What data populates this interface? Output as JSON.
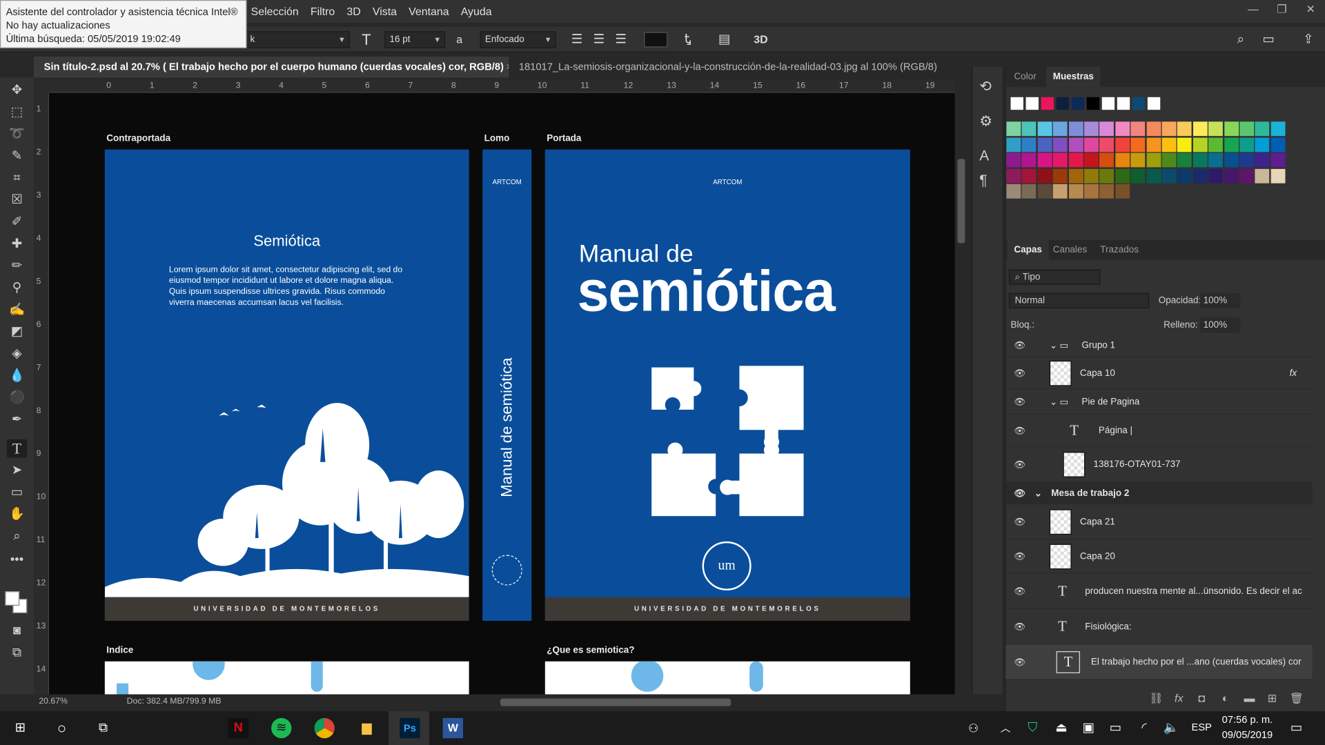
{
  "tooltip": {
    "line1": "Asistente del controlador y asistencia técnica Intel®",
    "line2": "No hay actualizaciones",
    "line3": "Última búsqueda: 05/05/2019 19:02:49"
  },
  "menu": [
    "Selección",
    "Filtro",
    "3D",
    "Vista",
    "Ventana",
    "Ayuda"
  ],
  "window_controls": {
    "minimize": "—",
    "restore": "❐",
    "close": "✕"
  },
  "options": {
    "font_style_partial": "k",
    "font_size_glyph": "T",
    "font_size": "16 pt",
    "aa_glyph": "a",
    "antialias": "Enfocado",
    "three_d": "3D"
  },
  "tabs": [
    {
      "label": "Sin título-2.psd al 20.7% (  El trabajo hecho por el  cuerpo humano (cuerdas  vocales) cor, RGB/8)",
      "close": "×"
    },
    {
      "label": "181017_La-semiosis-organizacional-y-la-construcción-de-la-realidad-03.jpg al 100% (RGB/8)",
      "close": "×"
    }
  ],
  "ruler": {
    "h_marks": [
      "0",
      "1",
      "2",
      "3",
      "4",
      "5",
      "6",
      "7",
      "8",
      "9",
      "10",
      "11",
      "12",
      "13",
      "14",
      "15",
      "16",
      "17",
      "18",
      "19"
    ],
    "v_marks": [
      "1",
      "2",
      "3",
      "4",
      "5",
      "6",
      "7",
      "8",
      "9",
      "10",
      "11",
      "12",
      "13",
      "14"
    ]
  },
  "canvas": {
    "labels": {
      "back": "Contraportada",
      "spine": "Lomo",
      "front": "Portada",
      "index": "Indice",
      "que": "¿Que es semiotica?"
    },
    "back": {
      "title": "Semiótica",
      "body": "Lorem ipsum dolor sit amet, consectetur adipiscing elit, sed do eiusmod tempor incididunt ut labore et dolore magna aliqua. Quis ipsum suspendisse ultrices gravida. Risus commodo viverra maecenas accumsan lacus vel facilisis.",
      "footer": "UNIVERSIDAD DE MONTEMORELOS"
    },
    "spine": {
      "publisher": "ARTCOM",
      "title": "Manual de semiótica"
    },
    "front": {
      "publisher": "ARTCOM",
      "title_small": "Manual de",
      "title_big": "semiótica",
      "seal_text": "um",
      "footer": "UNIVERSIDAD DE MONTEMORELOS"
    }
  },
  "status": {
    "zoom": "20.67%",
    "doc": "Doc: 382.4 MB/799.9 MB"
  },
  "color_panel": {
    "tabs": [
      "Color",
      "Muestras"
    ],
    "recent": [
      "#ffffff",
      "#ffffff",
      "#e8175d",
      "#0f1e3c",
      "#0c2a55",
      "#000000",
      "#ffffff",
      "#ffffff",
      "#0c4a73",
      "#ffffff"
    ],
    "grid": [
      [
        "#7fd3a0",
        "#4dc3b9",
        "#58c6e6",
        "#6aa6e0",
        "#7f8ed8",
        "#a98ad8",
        "#d88ad8",
        "#f08abf",
        "#f2857f",
        "#f58a5c",
        "#f8a85a",
        "#f8cb5a",
        "#ffea5a",
        "#c7e25a",
        "#8ad65a",
        "#5ac76f",
        "#2eb89b",
        "#1ab2d6"
      ],
      [
        "#2e9fc7",
        "#2f7fc7",
        "#4c63c0",
        "#7f4fc0",
        "#b04fbe",
        "#e0479f",
        "#ef4a6a",
        "#f2433a",
        "#f46a1c",
        "#f7941d",
        "#fdc010",
        "#f9ec10",
        "#b4d526",
        "#5bbb30",
        "#16a651",
        "#0e9d8a",
        "#009ed8",
        "#005eb8"
      ],
      [
        "#8e1b8e",
        "#b1158f",
        "#d91586",
        "#e5186a",
        "#e5184a",
        "#c4151c",
        "#d64e0e",
        "#e7850d",
        "#c79b0b",
        "#9aa10c",
        "#4e8b1a",
        "#16823c",
        "#08785f",
        "#0a6f8f",
        "#0a4f8f",
        "#1e3a8f",
        "#3e238f",
        "#5e1e8f"
      ],
      [
        "#8e1b5e",
        "#a3153a",
        "#8f1117",
        "#9a3a0a",
        "#a3650a",
        "#8f7a0a",
        "#6a7a0d",
        "#2e6a16",
        "#0e5f2e",
        "#0a5a4c",
        "#0a4c6a",
        "#0a3a6a",
        "#1a2a6a",
        "#2e1a6a",
        "#46166a",
        "#5e166a",
        "#c8b79a",
        "#e8d6b6"
      ],
      [
        "#9a8a76",
        "#7a6a56",
        "#5a4a3a",
        "#c8a070",
        "#b88a50",
        "#a87440",
        "#906030",
        "#7a5028"
      ]
    ]
  },
  "layers_panel": {
    "tabs": [
      "Capas",
      "Canales",
      "Trazados"
    ],
    "filter": "Tipo",
    "blend": "Normal",
    "opacity_label": "Opacidad:",
    "opacity": "100%",
    "lock_label": "Bloq.:",
    "fill_label": "Relleno:",
    "fill": "100%",
    "fx": "fx",
    "layers": [
      {
        "name": "Grupo 1",
        "kind": "group"
      },
      {
        "name": "Capa 10",
        "kind": "pixel"
      },
      {
        "name": "Pie de Pagina",
        "kind": "group"
      },
      {
        "name": "Página |",
        "kind": "text"
      },
      {
        "name": "138176-OTAY01-737",
        "kind": "pixel"
      },
      {
        "name": "Mesa de trabajo 2",
        "kind": "artboard"
      },
      {
        "name": "Capa 21",
        "kind": "pixel"
      },
      {
        "name": "Capa 20",
        "kind": "pixel"
      },
      {
        "name": "producen nuestra mente al...ünsonido.  Es decir el ac",
        "kind": "text"
      },
      {
        "name": "Fisiológica:",
        "kind": "text"
      },
      {
        "name": "El trabajo hecho por el ...ano (cuerdas  vocales) cor",
        "kind": "text"
      }
    ]
  },
  "taskbar": {
    "lang": "ESP",
    "time": "07:56 p. m.",
    "date": "09/05/2019"
  }
}
